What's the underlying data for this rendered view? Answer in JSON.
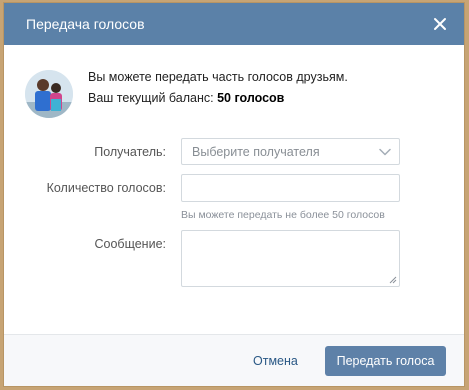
{
  "dialog": {
    "title": "Передача голосов",
    "close_label": "close"
  },
  "info": {
    "line1": "Вы можете передать часть голосов друзьям.",
    "balance_label": "Ваш текущий баланс: ",
    "balance_value": "50 голосов"
  },
  "form": {
    "recipient_label": "Получатель:",
    "recipient_placeholder": "Выберите получателя",
    "count_label": "Количество голосов:",
    "count_value": "",
    "count_hint": "Вы можете передать не более 50 голосов",
    "message_label": "Сообщение:",
    "message_value": ""
  },
  "footer": {
    "cancel_label": "Отмена",
    "submit_label": "Передать голоса"
  },
  "colors": {
    "header": "#5b81a8",
    "submit": "#5e81a8",
    "link": "#2a5885",
    "outer_frame": "#c7a474"
  },
  "icons": {
    "close": "close-icon",
    "dropdown": "chevron-down-icon",
    "resize": "resize-grip-icon"
  }
}
